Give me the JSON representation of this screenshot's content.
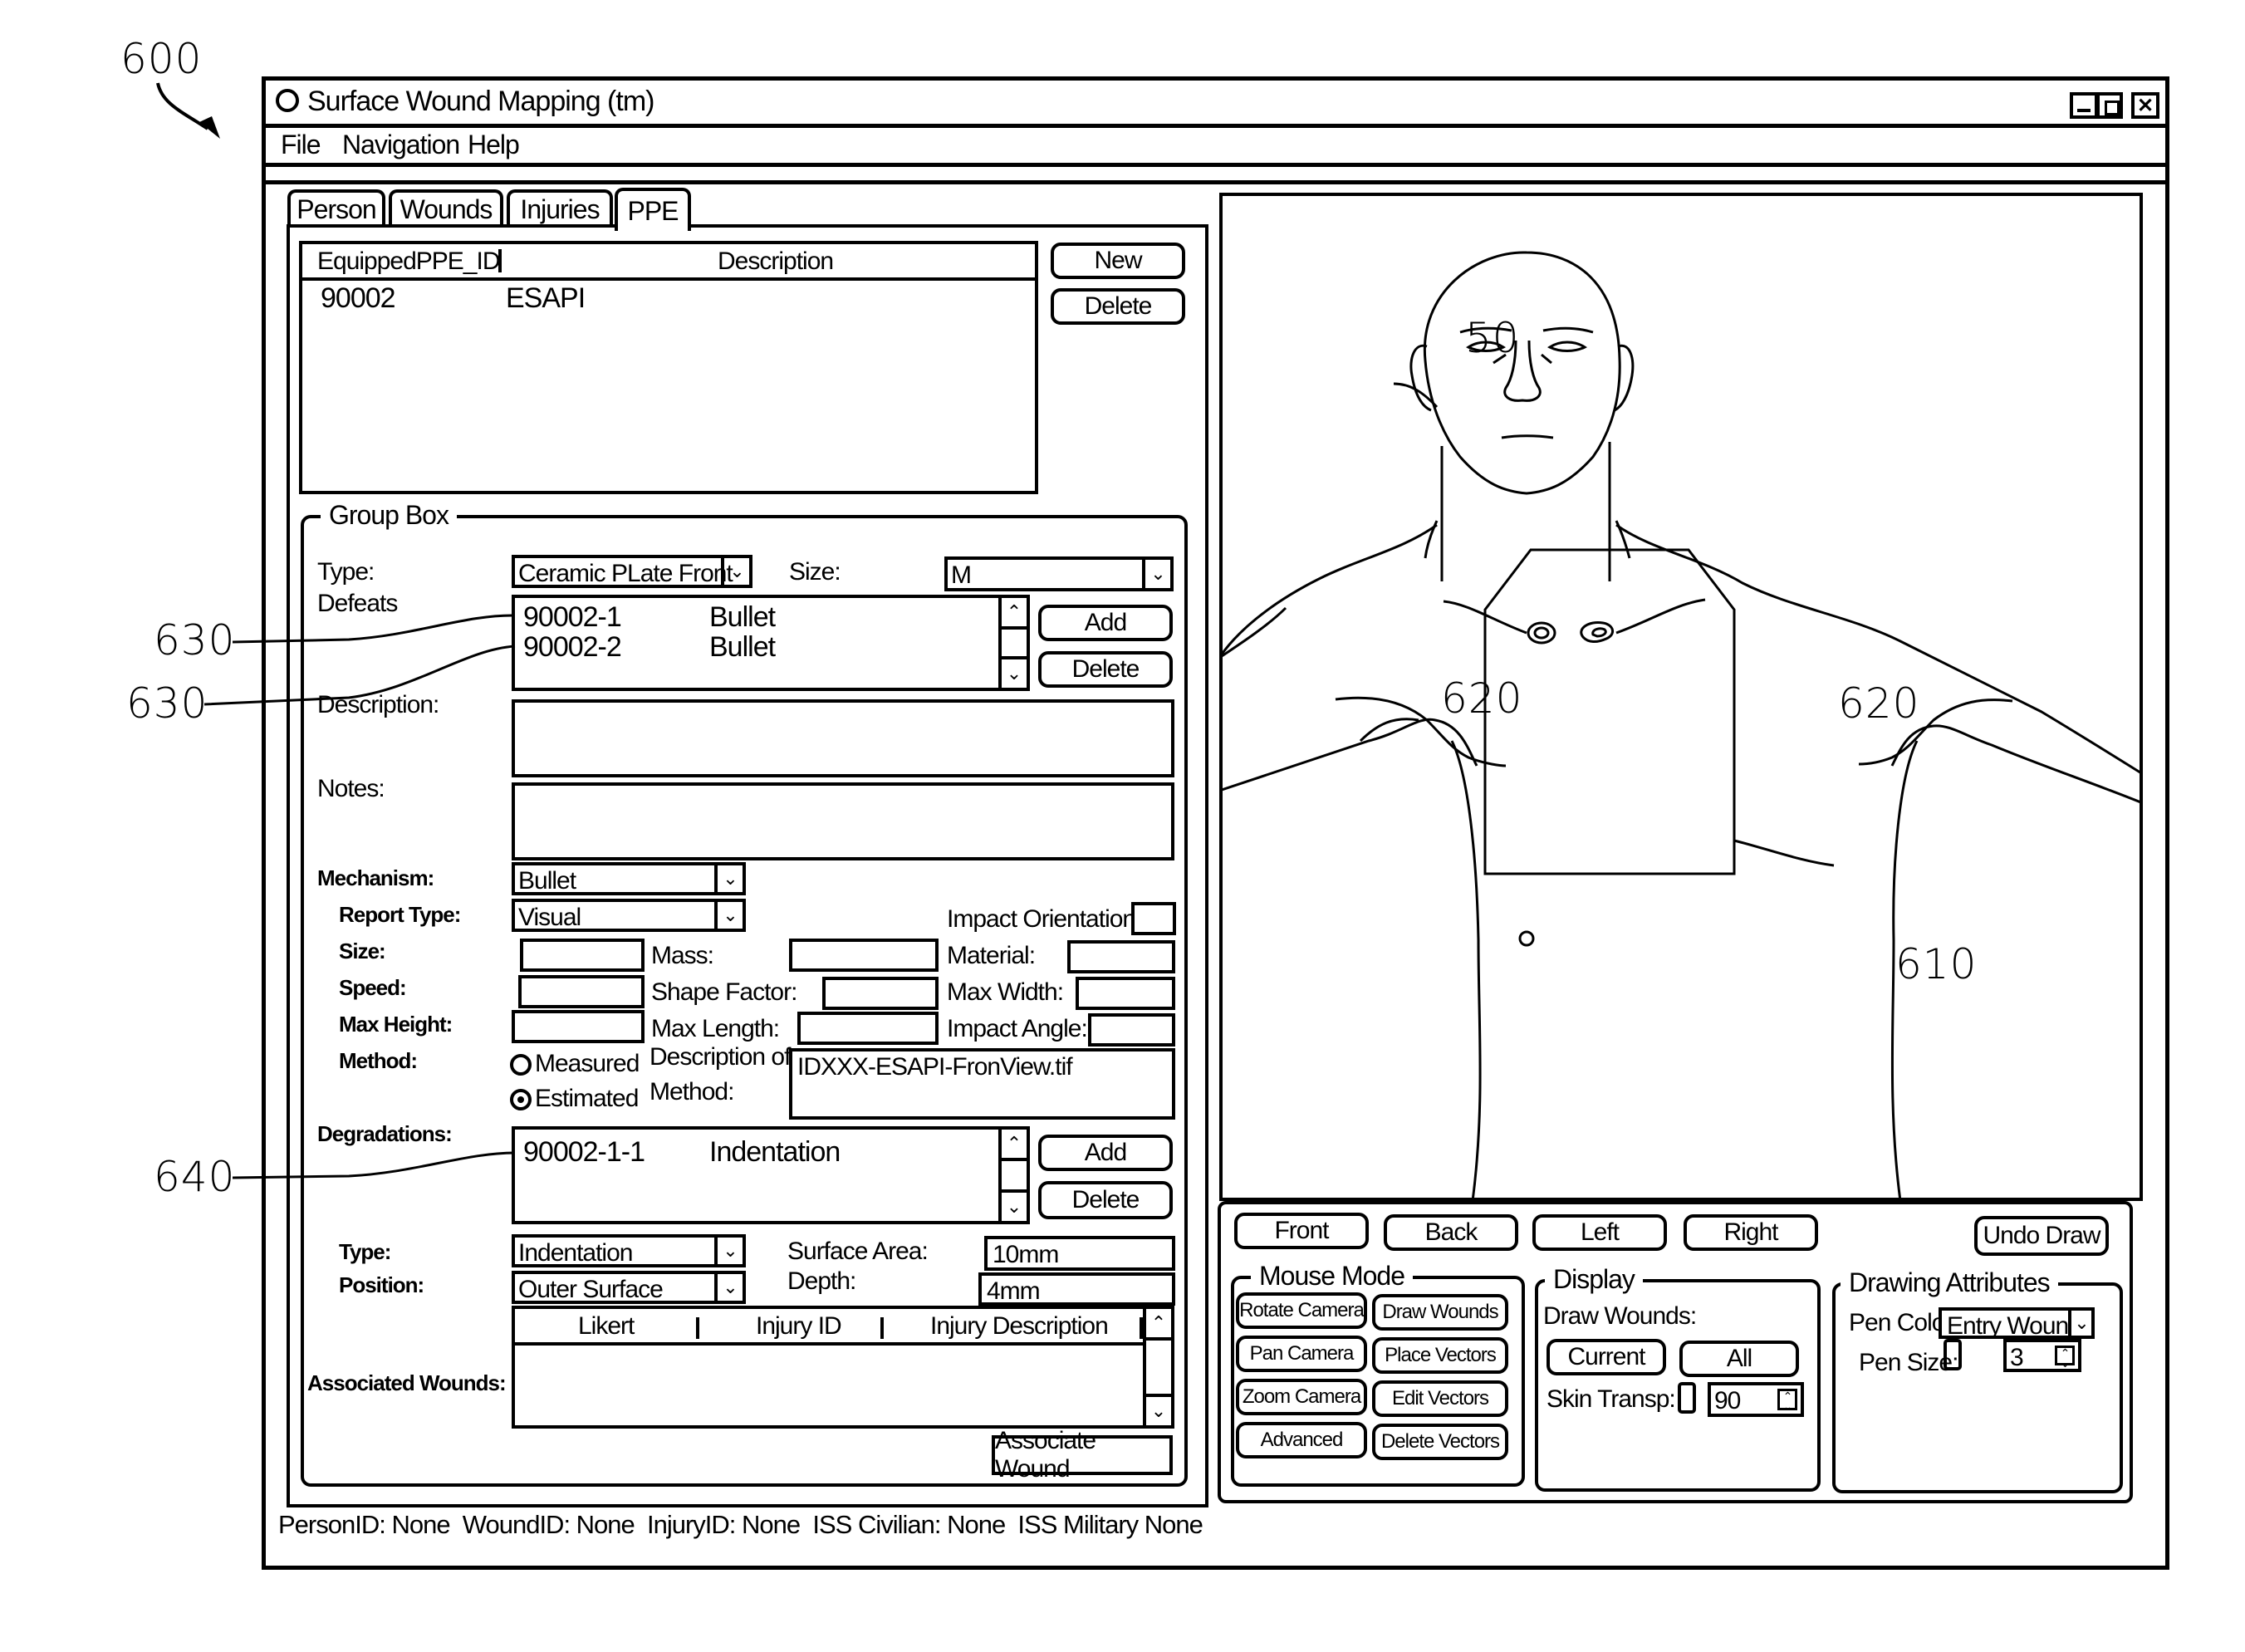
{
  "figure": {
    "ref_window": "600",
    "ref_defeats_1": "630",
    "ref_defeats_2": "630",
    "ref_degradation": "640",
    "ref_body_model": "50",
    "ref_wound_left": "620",
    "ref_wound_right": "620",
    "ref_plate": "610"
  },
  "window": {
    "title": "Surface Wound Mapping (tm)",
    "controls": {
      "minimize": "_",
      "maximize": "□",
      "close": "✕"
    }
  },
  "menu": [
    "File",
    "Navigation",
    "Help"
  ],
  "tabs": [
    {
      "label": "Person",
      "active": false
    },
    {
      "label": "Wounds",
      "active": false
    },
    {
      "label": "Injuries",
      "active": false
    },
    {
      "label": "PPE",
      "active": true
    }
  ],
  "ppe_table": {
    "columns": [
      "EquippedPPE_ID",
      "Description"
    ],
    "rows": [
      {
        "id": "90002",
        "description": "ESAPI"
      }
    ],
    "new_label": "New",
    "delete_label": "Delete"
  },
  "group_box": {
    "title": "Group Box",
    "type_label": "Type:",
    "type_value": "Ceramic PLate Front",
    "size_label": "Size:",
    "size_value": "M",
    "defeats_label": "Defeats",
    "defeats": [
      {
        "id": "90002-1",
        "type": "Bullet"
      },
      {
        "id": "90002-2",
        "type": "Bullet"
      }
    ],
    "defeats_add": "Add",
    "defeats_delete": "Delete",
    "description_label": "Description:",
    "description_value": "",
    "notes_label": "Notes:",
    "notes_value": "",
    "mechanism_label": "Mechanism:",
    "mechanism_value": "Bullet",
    "report_type_label": "Report Type:",
    "report_type_value": "Visual",
    "impact_orientation_label": "Impact Orientation:",
    "size_field_label": "Size:",
    "mass_label": "Mass:",
    "material_label": "Material:",
    "speed_label": "Speed:",
    "shape_factor_label": "Shape Factor:",
    "max_width_label": "Max Width:",
    "max_height_label": "Max Height:",
    "max_length_label": "Max Length:",
    "impact_angle_label": "Impact Angle:",
    "method_label": "Method:",
    "method_options": [
      {
        "label": "Measured",
        "selected": false
      },
      {
        "label": "Estimated",
        "selected": true
      }
    ],
    "desc_method_label_1": "Description of",
    "desc_method_label_2": "Method:",
    "desc_method_value": "IDXXX-ESAPI-FronView.tif",
    "degradations_label": "Degradations:",
    "degradations": [
      {
        "id": "90002-1-1",
        "type": "Indentation"
      }
    ],
    "degradations_add": "Add",
    "degradations_delete": "Delete",
    "deg_type_label": "Type:",
    "deg_type_value": "Indentation",
    "deg_position_label": "Position:",
    "deg_position_value": "Outer Surface",
    "surface_area_label": "Surface Area:",
    "surface_area_value": "10mm",
    "depth_label": "Depth:",
    "depth_value": "4mm",
    "assoc_columns": [
      "Likert",
      "Injury ID",
      "Injury Description"
    ],
    "assoc_label": "Associated Wounds:",
    "associate_button": "Associate Wound"
  },
  "status_bar": "PersonID: None  WoundID: None  InjuryID: None  ISS Civilian: None  ISS Military None",
  "view_buttons": [
    "Front",
    "Back",
    "Left",
    "Right"
  ],
  "undo_draw": "Undo Draw",
  "mouse_mode": {
    "title": "Mouse Mode",
    "buttons": [
      "Rotate Camera",
      "Draw Wounds",
      "Pan Camera",
      "Place Vectors",
      "Zoom Camera",
      "Edit Vectors",
      "Advanced",
      "Delete Vectors"
    ]
  },
  "display": {
    "title": "Display",
    "draw_wounds_label": "Draw Wounds:",
    "current_label": "Current",
    "all_label": "All",
    "skin_transp_label": "Skin Transp:",
    "skin_transp_value": "90"
  },
  "drawing_attributes": {
    "title": "Drawing Attributes",
    "pen_color_label": "Pen Color:",
    "pen_color_value": "Entry Wound",
    "pen_size_label": "Pen Size:",
    "pen_size_value": "3"
  }
}
